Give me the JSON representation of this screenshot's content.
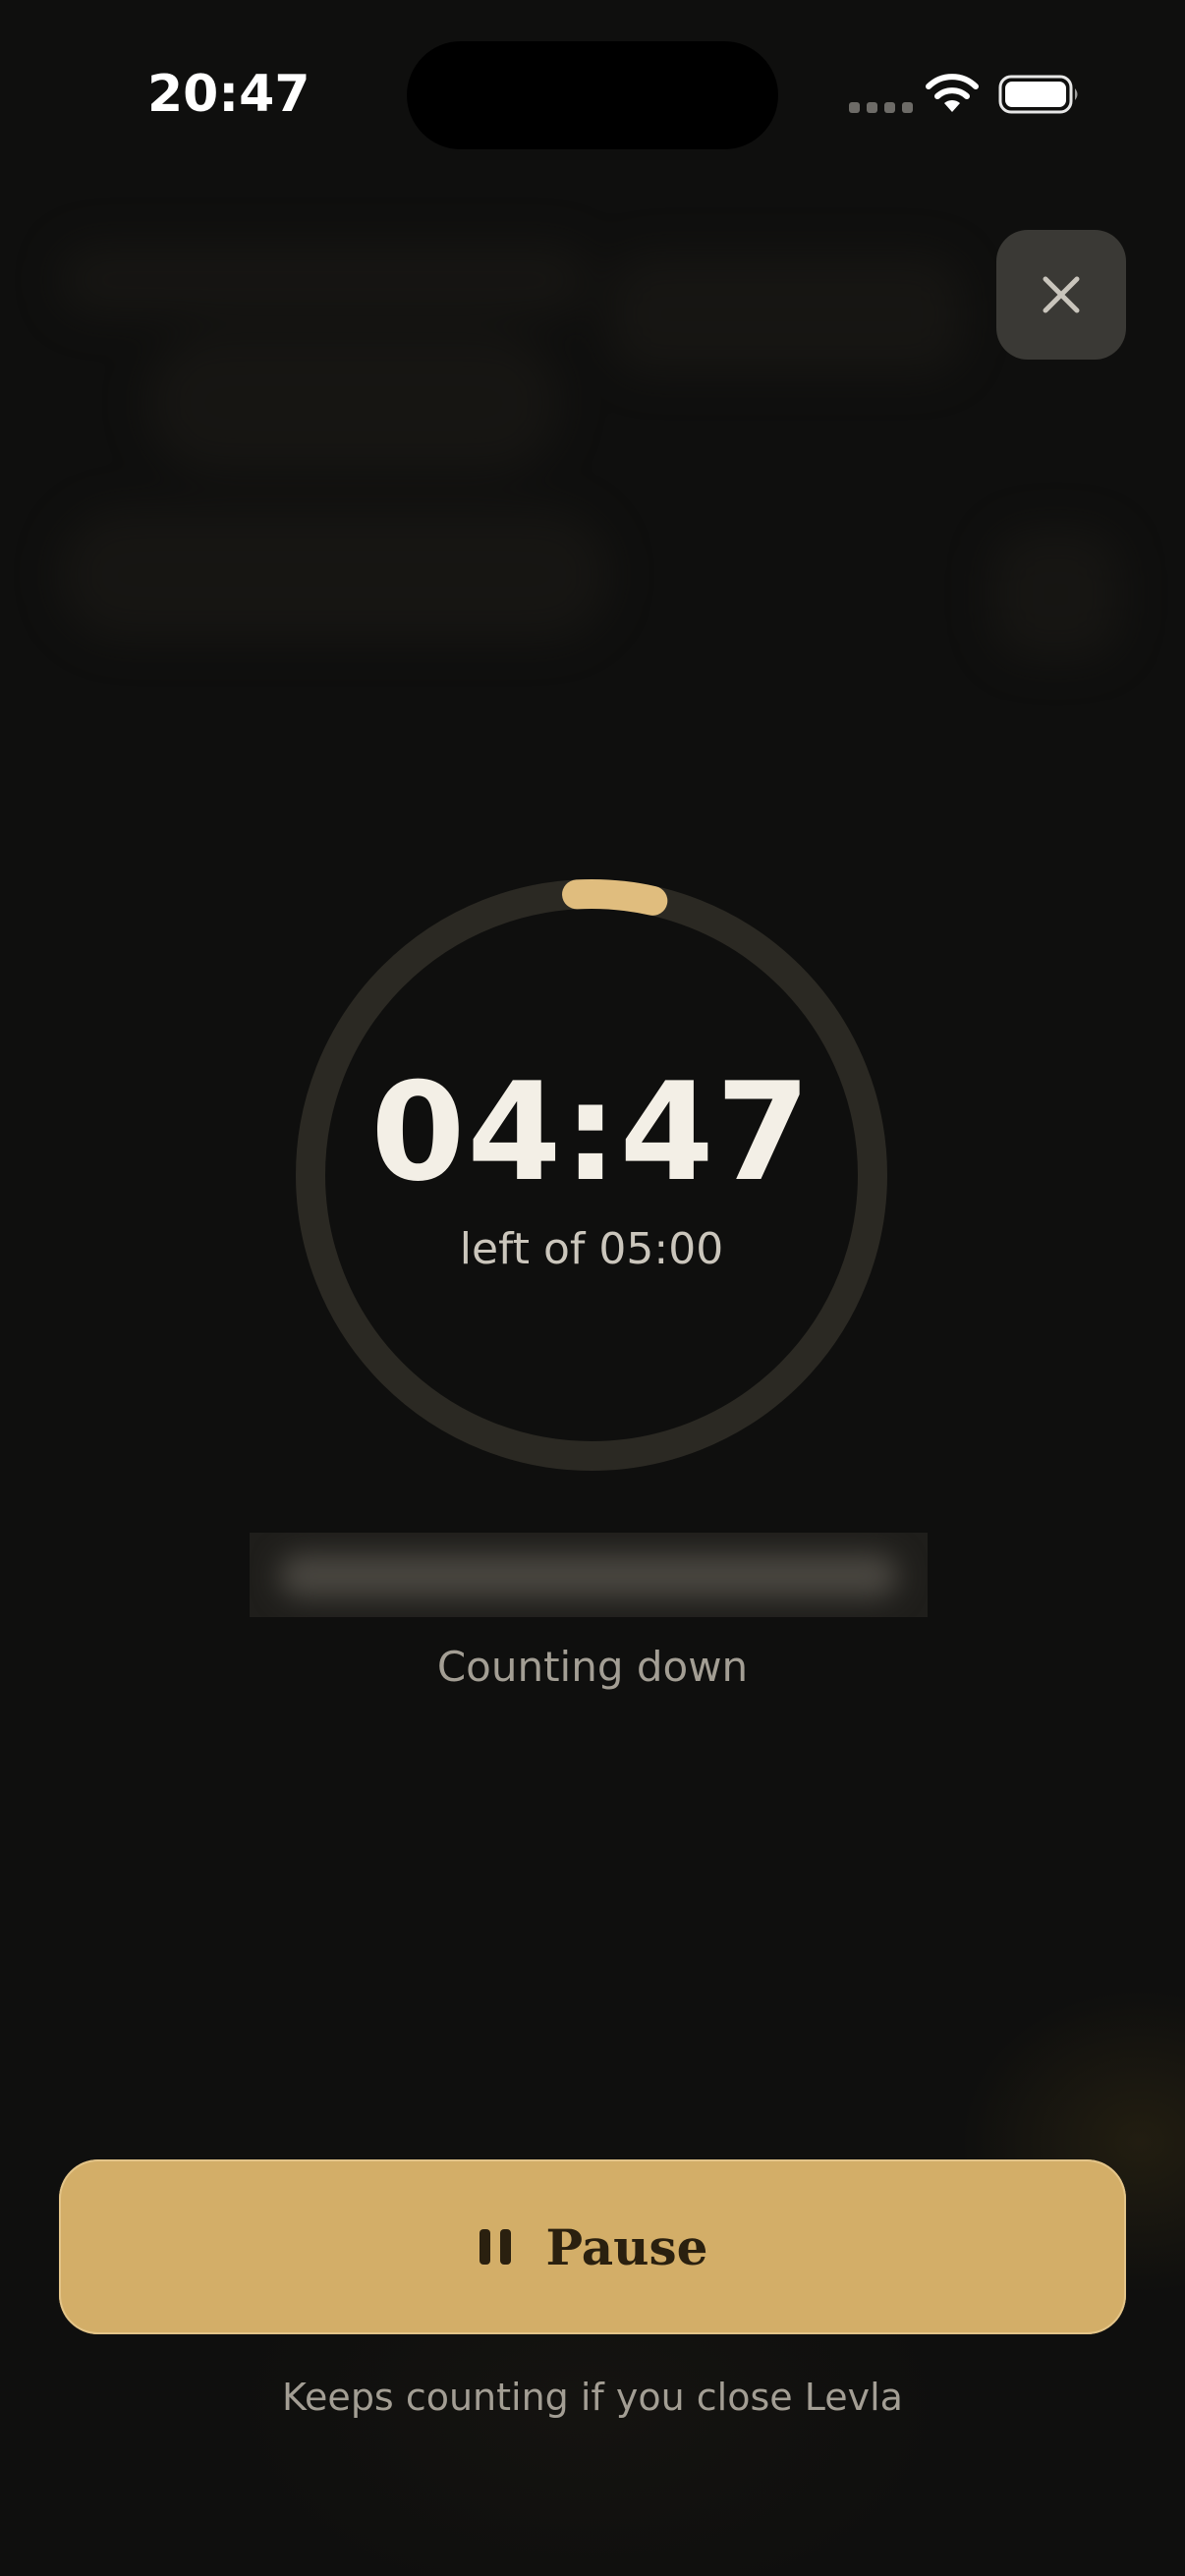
{
  "status_bar": {
    "time": "20:47"
  },
  "colors": {
    "background": "#0f0f0e",
    "accent": "#d3ae68",
    "ring_track": "#2b2923",
    "ring_progress": "#e0bd7e",
    "text_primary": "#f3efe6",
    "text_secondary": "#a39e94"
  },
  "icons": {
    "close": "close-icon",
    "pause": "pause-icon",
    "wifi": "wifi-icon",
    "battery": "battery-icon"
  },
  "timer": {
    "remaining": "04:47",
    "subtitle": "left of 05:00",
    "total_seconds": 300,
    "remaining_seconds": 287,
    "progress_fraction": 0.0433
  },
  "status": {
    "state_label": "Counting down"
  },
  "controls": {
    "pause_label": "Pause"
  },
  "footer": {
    "note": "Keeps counting if you close Levla"
  }
}
